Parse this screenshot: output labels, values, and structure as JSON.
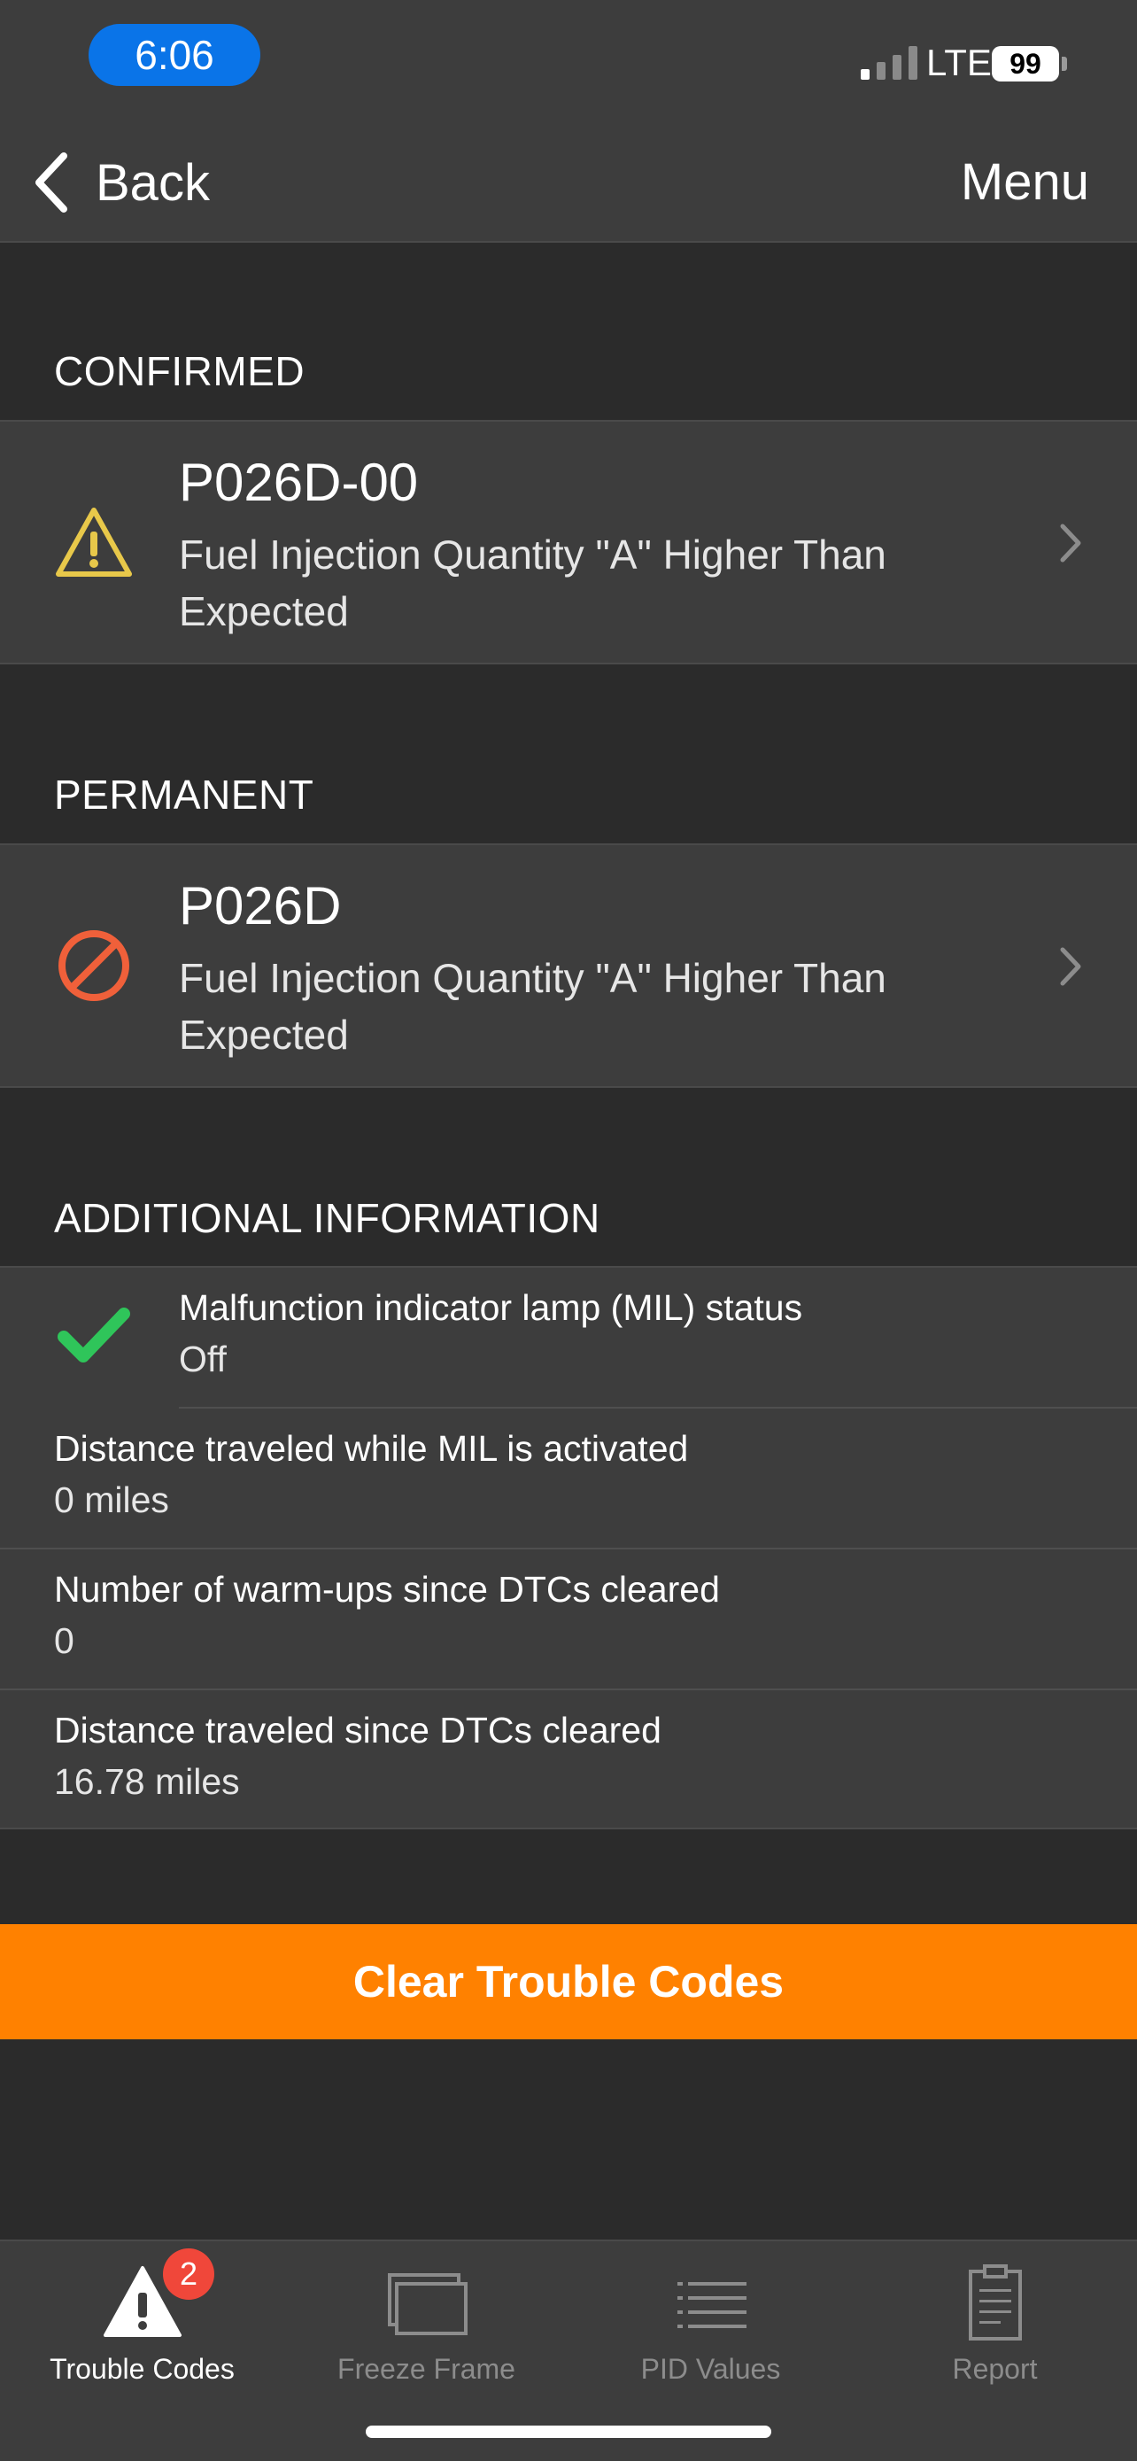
{
  "status_bar": {
    "time": "6:06",
    "network": "LTE",
    "battery": "99"
  },
  "nav": {
    "back_label": "Back",
    "menu_label": "Menu"
  },
  "sections": {
    "confirmed": {
      "header": "CONFIRMED",
      "code": "P026D-00",
      "description": "Fuel Injection Quantity \"A\" Higher Than Expected",
      "icon": "warning-triangle-icon",
      "icon_color": "#e8c84a"
    },
    "permanent": {
      "header": "PERMANENT",
      "code": "P026D",
      "description": "Fuel Injection Quantity \"A\" Higher Than Expected",
      "icon": "prohibited-icon",
      "icon_color": "#f0603a"
    },
    "additional": {
      "header": "ADDITIONAL INFORMATION",
      "items": [
        {
          "label": "Malfunction indicator lamp (MIL) status",
          "value": "Off",
          "icon": "checkmark-icon"
        },
        {
          "label": "Distance traveled while MIL is activated",
          "value": "0 miles"
        },
        {
          "label": "Number of warm-ups since DTCs cleared",
          "value": "0"
        },
        {
          "label": "Distance traveled since DTCs cleared",
          "value": "16.78 miles"
        }
      ]
    }
  },
  "actions": {
    "clear_label": "Clear Trouble Codes"
  },
  "tabs": [
    {
      "label": "Trouble Codes",
      "icon": "warning-triangle-icon",
      "badge": "2",
      "active": true
    },
    {
      "label": "Freeze Frame",
      "icon": "freeze-frame-icon",
      "active": false
    },
    {
      "label": "PID Values",
      "icon": "list-icon",
      "active": false
    },
    {
      "label": "Report",
      "icon": "clipboard-icon",
      "active": false
    }
  ],
  "colors": {
    "accent": "#ff8100",
    "background": "#2b2b2b",
    "panel": "#3d3d3d",
    "status_pill": "#0a74e8",
    "check_green": "#2fc55a",
    "badge_red": "#f0473a"
  }
}
